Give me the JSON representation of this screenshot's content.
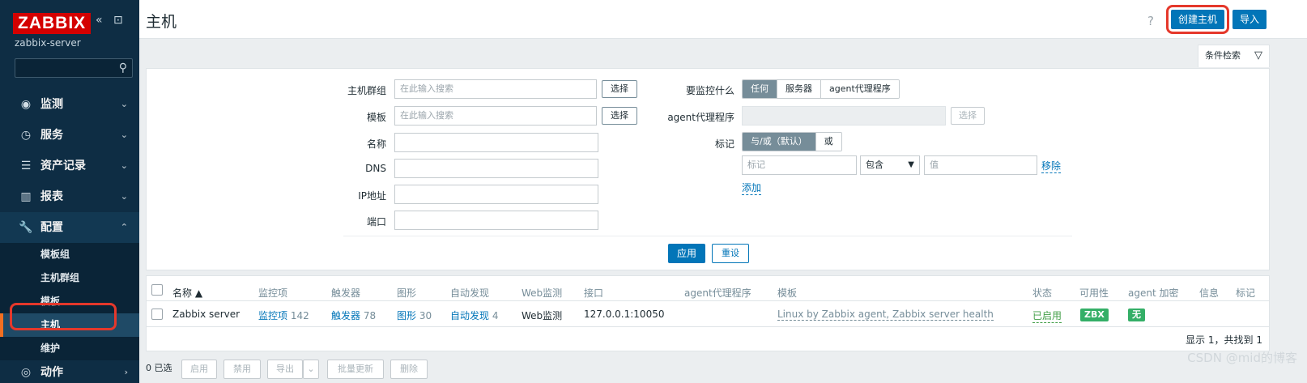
{
  "sidebar": {
    "logo": "ZABBIX",
    "collapse_icon": "«",
    "expand_icon": "⊡",
    "server": "zabbix-server",
    "search_placeholder": "",
    "menu": [
      {
        "label": "监测",
        "icon": "eye-icon",
        "glyph": "◉",
        "chevron": "⌄"
      },
      {
        "label": "服务",
        "icon": "clock-icon",
        "glyph": "◷",
        "chevron": "⌄"
      },
      {
        "label": "资产记录",
        "icon": "list-icon",
        "glyph": "☰",
        "chevron": "⌄"
      },
      {
        "label": "报表",
        "icon": "chart-icon",
        "glyph": "▥",
        "chevron": "⌄"
      },
      {
        "label": "配置",
        "icon": "wrench-icon",
        "glyph": "🔧",
        "chevron": "⌃"
      }
    ],
    "submenu": [
      "模板组",
      "主机群组",
      "模板",
      "主机",
      "维护"
    ],
    "last_menu": {
      "label": "动作",
      "glyph": "◎",
      "chevron": "›"
    }
  },
  "header": {
    "title": "主机",
    "help": "?",
    "create_label": "创建主机",
    "import_label": "导入"
  },
  "filter": {
    "tab_label": "条件检索",
    "host_groups_label": "主机群组",
    "templates_label": "模板",
    "name_label": "名称",
    "dns_label": "DNS",
    "ip_label": "IP地址",
    "port_label": "端口",
    "search_placeholder": "在此输入搜索",
    "select_label": "选择",
    "monitored_by_label": "要监控什么",
    "monitored_by_options": [
      "任何",
      "服务器",
      "agent代理程序"
    ],
    "proxy_label": "agent代理程序",
    "tags_label": "标记",
    "tag_ops": [
      "与/或（默认）",
      "或"
    ],
    "tag_placeholder": "标记",
    "tag_operator": "包含",
    "value_placeholder": "值",
    "remove_label": "移除",
    "add_label": "添加",
    "apply_label": "应用",
    "reset_label": "重设"
  },
  "table": {
    "headers": {
      "name": "名称 ▲",
      "items": "监控项",
      "triggers": "触发器",
      "graphs": "图形",
      "discovery": "自动发现",
      "web": "Web监测",
      "interface": "接口",
      "proxy": "agent代理程序",
      "templates": "模板",
      "status": "状态",
      "availability": "可用性",
      "encryption": "agent 加密",
      "info": "信息",
      "tags": "标记"
    },
    "row": {
      "name": "Zabbix server",
      "items": "监控项",
      "items_count": "142",
      "triggers": "触发器",
      "triggers_count": "78",
      "graphs": "图形",
      "graphs_count": "30",
      "discovery": "自动发现",
      "discovery_count": "4",
      "web": "Web监测",
      "interface": "127.0.0.1:10050",
      "templates": "Linux by Zabbix agent, Zabbix server health",
      "status": "已启用",
      "availability": "ZBX",
      "encryption": "无"
    },
    "summary": "显示 1，共找到 1"
  },
  "bottom": {
    "selected": "0 已选",
    "buttons": [
      "启用",
      "禁用",
      "导出",
      "批量更新",
      "删除"
    ],
    "export_dd": "⌄"
  },
  "watermark": "CSDN @mid的博客",
  "colors": {
    "sidebar": "#0e2d44",
    "primary": "#0275b8",
    "highlight": "#e5382b",
    "logo": "#d40000",
    "enabled": "#429e47",
    "badge": "#34af67"
  }
}
